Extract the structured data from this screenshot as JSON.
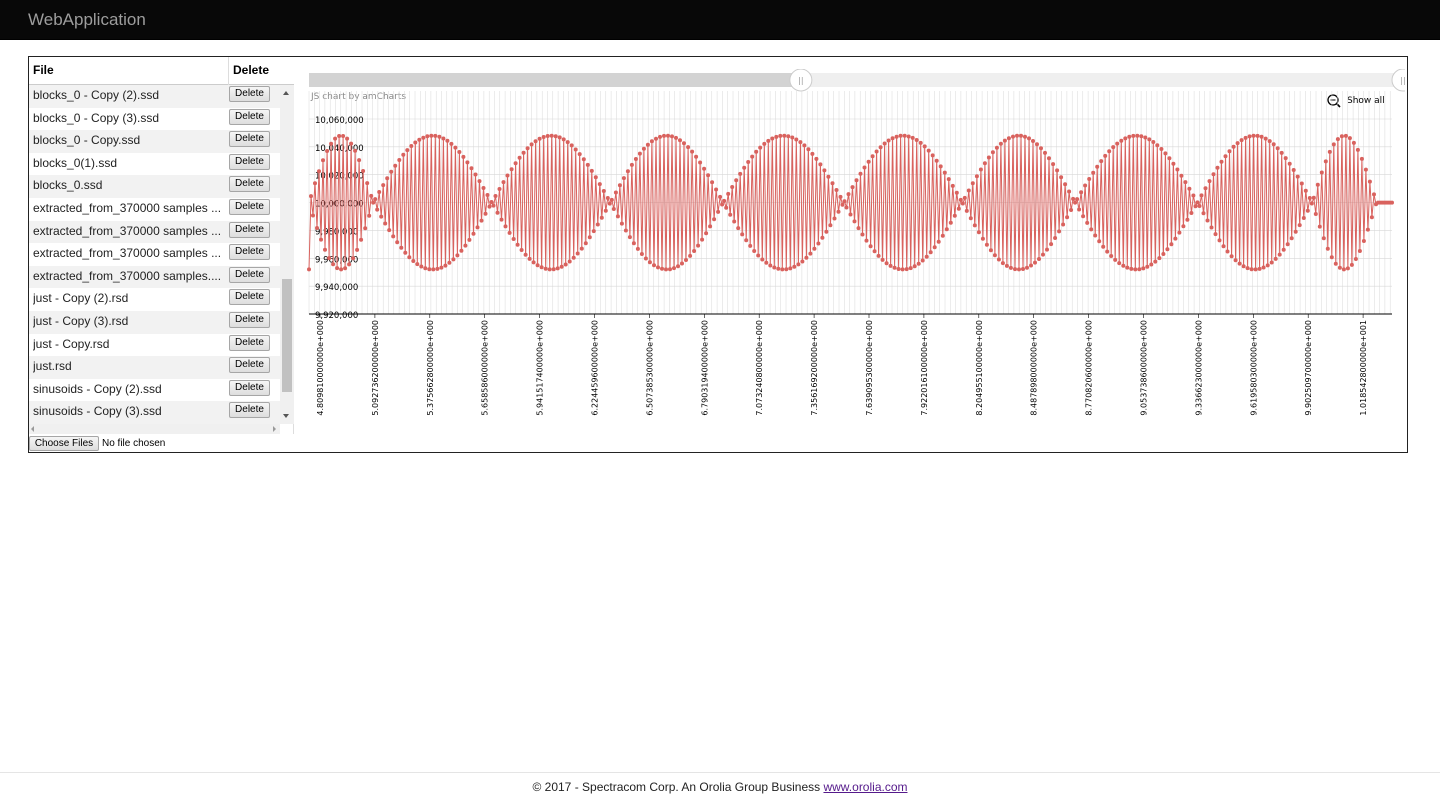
{
  "app": {
    "title": "WebApplication"
  },
  "file_table": {
    "col_file": "File",
    "col_delete": "Delete",
    "files": [
      "blocks_0 - Copy (2).ssd",
      "blocks_0 - Copy (3).ssd",
      "blocks_0 - Copy.ssd",
      "blocks_0(1).ssd",
      "blocks_0.ssd",
      "extracted_from_370000 samples ...",
      "extracted_from_370000 samples ...",
      "extracted_from_370000 samples ...",
      "extracted_from_370000 samples....",
      "just - Copy (2).rsd",
      "just - Copy (3).rsd",
      "just - Copy.rsd",
      "just.rsd",
      "sinusoids - Copy (2).ssd",
      "sinusoids - Copy (3).ssd"
    ],
    "delete_label": "Delete"
  },
  "upload": {
    "button_label": "Choose Files",
    "status": "No file chosen"
  },
  "chart": {
    "credit": "JS chart by amCharts",
    "show_all": "Show all",
    "grip": "||",
    "scroll_fraction": [
      0,
      0.45
    ],
    "colors": {
      "series": "#d9625e",
      "grid": "#d8d8d8",
      "axis": "#000000",
      "scrollbar": "#d3d3d3",
      "scrollbar_track": "#efefef"
    },
    "icons": {
      "zoom": "magnifier-icon"
    }
  },
  "chart_data": {
    "type": "line",
    "markers": true,
    "title": "",
    "ylabel": "",
    "xlabel": "",
    "ylim": [
      9920000,
      10060000
    ],
    "yticks": [
      "10,060,000",
      "10,040,000",
      "10,020,000",
      "10,000,000",
      "9,980,000",
      "9,960,000",
      "9,940,000",
      "9,920,000"
    ],
    "xticks": [
      "4.809810000000e+000",
      "5.092736200000e+000",
      "5.375662800000e+000",
      "5.658586000000e+000",
      "5.941517400000e+000",
      "6.224459600000e+000",
      "6.507385300000e+000",
      "6.790319400000e+000",
      "7.073240800000e+000",
      "7.356169200000e+000",
      "7.639095300000e+000",
      "7.922016100000e+000",
      "8.204955100000e+000",
      "8.487898000000e+000",
      "8.770820600000e+000",
      "9.053738600000e+000",
      "9.336623000000e+000",
      "9.619580300000e+000",
      "9.902509700000e+000",
      "1.018542800000e+001"
    ],
    "series": [
      {
        "description": "amplitude-modulated oscillation centred on 10,000,000",
        "center": 10000000,
        "amplitude": 48000,
        "envelope_nodes": [
          4.81,
          5.14,
          5.75,
          6.36,
          6.94,
          7.56,
          8.17,
          8.75,
          9.38,
          9.97
        ],
        "envelope_peaks": [
          5.45,
          6.04,
          6.66,
          7.27,
          7.86,
          8.47,
          9.07,
          9.68
        ],
        "x_start": 4.8098,
        "x_end": 10.38
      }
    ]
  },
  "footer": {
    "text": "© 2017 - Spectracom Corp. An Orolia Group Business ",
    "link": "www.orolia.com"
  }
}
